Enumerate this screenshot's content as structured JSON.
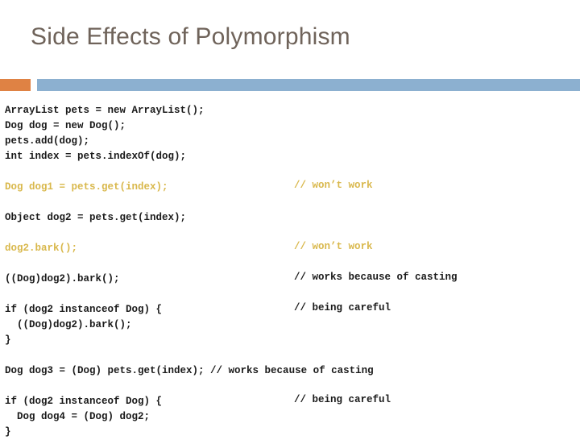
{
  "slide": {
    "title": "Side Effects of Polymorphism",
    "colors": {
      "title_text": "#6F635A",
      "accent_orange": "#DF8244",
      "divider_blue": "#8CB0D0",
      "code_black": "#1A1A1A",
      "code_gold": "#D9B84C",
      "background": "#FFFFFF"
    }
  },
  "code": {
    "blocks": [
      {
        "id": "setup",
        "lines": [
          {
            "text": "ArrayList pets = new ArrayList();",
            "color": "black",
            "comment": ""
          },
          {
            "text": "Dog dog = new Dog();",
            "color": "black",
            "comment": ""
          },
          {
            "text": "pets.add(dog);",
            "color": "black",
            "comment": ""
          },
          {
            "text": "int index = pets.indexOf(dog);",
            "color": "black",
            "comment": ""
          }
        ]
      },
      {
        "id": "dog1-wont-work",
        "lines": [
          {
            "text": "Dog dog1 = pets.get(index);",
            "color": "gold",
            "comment": "// won’t work",
            "comment_color": "gold"
          }
        ]
      },
      {
        "id": "dog2-object",
        "lines": [
          {
            "text": "Object dog2 = pets.get(index);",
            "color": "black",
            "comment": ""
          }
        ]
      },
      {
        "id": "dog2-bark-wont-work",
        "lines": [
          {
            "text": "dog2.bark();",
            "color": "gold",
            "comment": "// won’t work",
            "comment_color": "gold"
          }
        ]
      },
      {
        "id": "cast-bark-works",
        "lines": [
          {
            "text": "((Dog)dog2).bark();",
            "color": "black",
            "comment": "// works because of casting",
            "comment_color": "black"
          }
        ]
      },
      {
        "id": "instanceof-bark",
        "lines": [
          {
            "text": "if (dog2 instanceof Dog) {",
            "color": "black",
            "comment": "// being careful",
            "comment_color": "black"
          },
          {
            "text": "  ((Dog)dog2).bark();",
            "color": "black",
            "comment": ""
          },
          {
            "text": "}",
            "color": "black",
            "comment": ""
          }
        ]
      },
      {
        "id": "dog3-cast-get",
        "lines": [
          {
            "text": "Dog dog3 = (Dog) pets.get(index); ",
            "color": "black",
            "comment": "// works because of casting",
            "comment_color": "black",
            "comment_inline": true
          }
        ]
      },
      {
        "id": "instanceof-assign",
        "lines": [
          {
            "text": "if (dog2 instanceof Dog) {",
            "color": "black",
            "comment": "// being careful",
            "comment_color": "black"
          },
          {
            "text": "  Dog dog4 = (Dog) dog2;",
            "color": "black",
            "comment": ""
          },
          {
            "text": "}",
            "color": "black",
            "comment": ""
          }
        ]
      }
    ]
  }
}
